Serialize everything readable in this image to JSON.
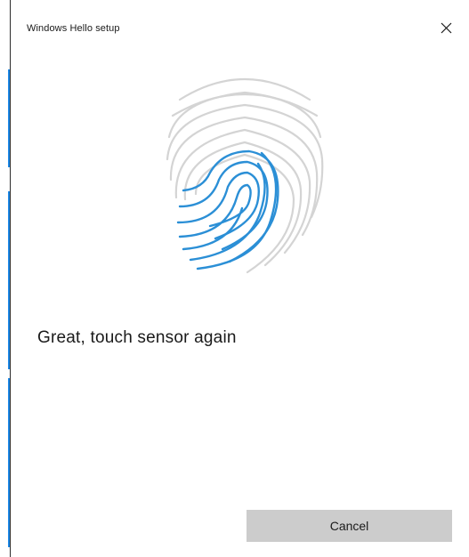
{
  "window": {
    "title": "Windows Hello setup",
    "close_icon": "close-icon"
  },
  "fingerprint": {
    "icon": "fingerprint-icon",
    "scanned_color": "#2b8fd6",
    "unscanned_color": "#d4d4d4"
  },
  "main": {
    "message": "Great, touch sensor again"
  },
  "footer": {
    "cancel_label": "Cancel"
  },
  "colors": {
    "accent": "#1e88e5",
    "button_bg": "#cccccc"
  }
}
